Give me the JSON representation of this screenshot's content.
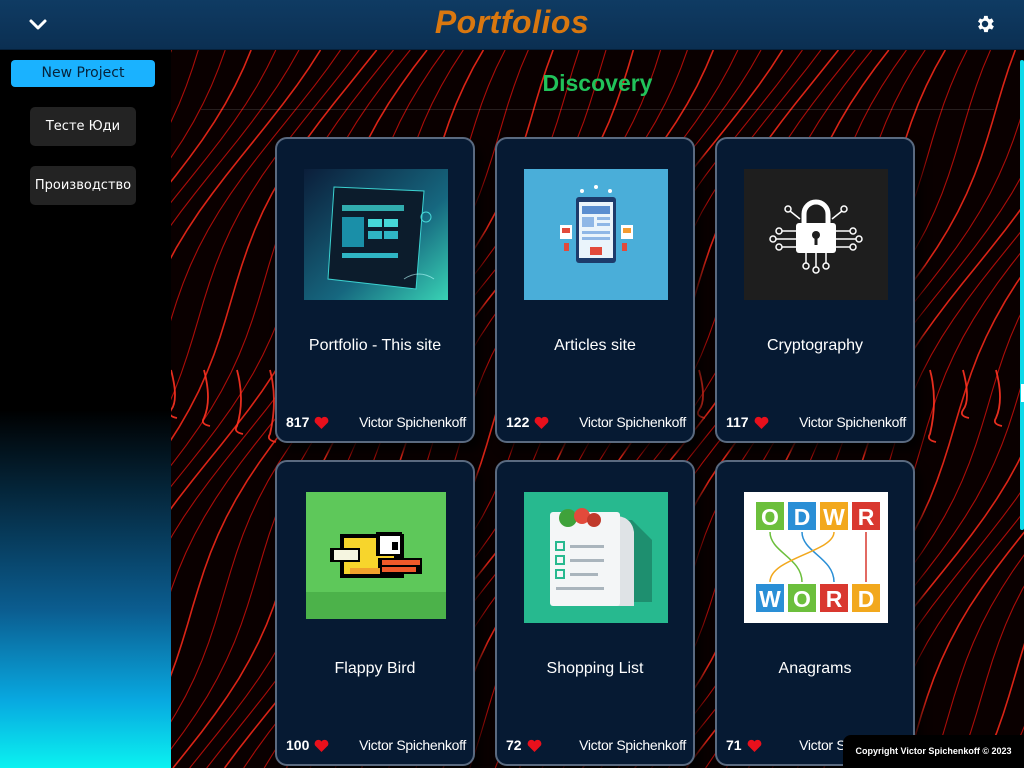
{
  "header": {
    "title": "Portfolios",
    "menu_icon": "chevron-down-icon",
    "settings_icon": "gear-icon"
  },
  "sidebar": {
    "new_project_label": "New Project",
    "items": [
      {
        "label": "Тесте Юди"
      },
      {
        "label": "Производство"
      }
    ]
  },
  "main": {
    "section_title": "Discovery",
    "cards": [
      {
        "title": "Portfolio - This site",
        "likes": "817",
        "author": "Victor Spichenkoff"
      },
      {
        "title": "Articles site",
        "likes": "122",
        "author": "Victor Spichenkoff"
      },
      {
        "title": "Cryptography",
        "likes": "117",
        "author": "Victor Spichenkoff"
      },
      {
        "title": "Flappy Bird",
        "likes": "100",
        "author": "Victor Spichenkoff"
      },
      {
        "title": "Shopping List",
        "likes": "72",
        "author": "Victor Spichenkoff"
      },
      {
        "title": "Anagrams",
        "likes": "71",
        "author": "Victor Spichenkoff"
      }
    ],
    "anagram_top_letters": [
      "O",
      "D",
      "W",
      "R"
    ],
    "anagram_bottom_letters": [
      "W",
      "O",
      "R",
      "D"
    ]
  },
  "footer": {
    "copyright": "Copyright Victor Spichenkoff © 2023"
  },
  "colors": {
    "title_orange": "#d9770f",
    "discovery_green": "#21c25a",
    "new_project_blue": "#1ab2ff",
    "heart_red": "#e8101c"
  }
}
